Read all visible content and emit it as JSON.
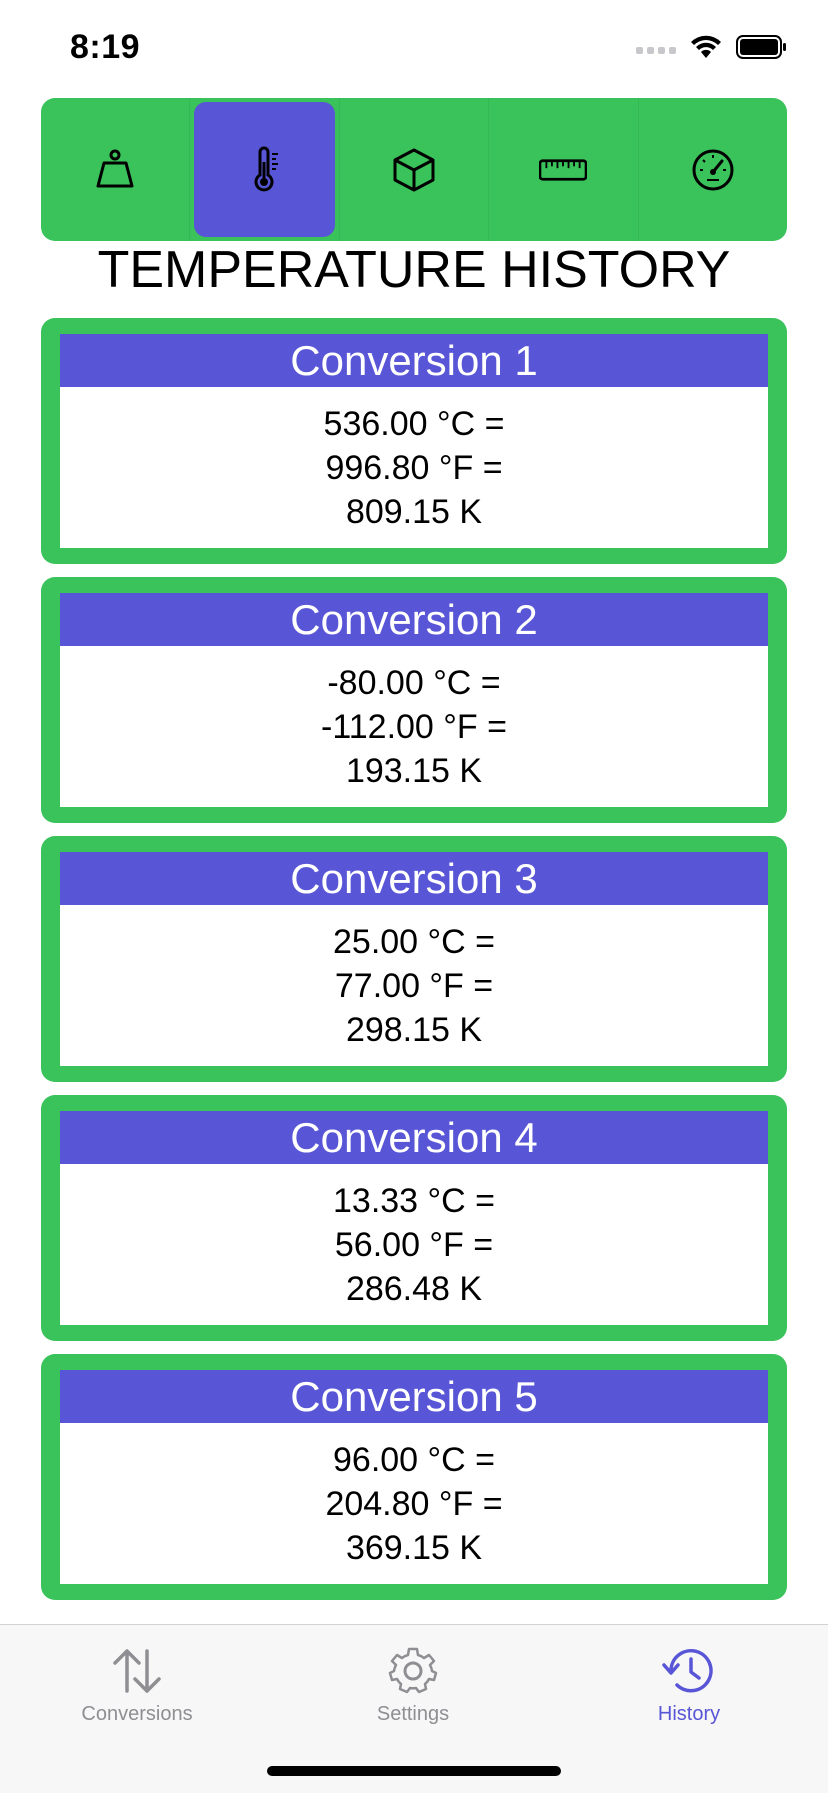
{
  "status": {
    "time": "8:19"
  },
  "categories": [
    {
      "icon": "weight-icon",
      "selected": false
    },
    {
      "icon": "thermometer-icon",
      "selected": true
    },
    {
      "icon": "cube-icon",
      "selected": false
    },
    {
      "icon": "ruler-icon",
      "selected": false
    },
    {
      "icon": "speedometer-icon",
      "selected": false
    }
  ],
  "page_title": "TEMPERATURE HISTORY",
  "history": [
    {
      "title": "Conversion 1",
      "celsius": "536.00 °C =",
      "fahrenheit": "996.80 °F =",
      "kelvin": "809.15 K"
    },
    {
      "title": "Conversion 2",
      "celsius": "-80.00 °C =",
      "fahrenheit": "-112.00 °F =",
      "kelvin": "193.15 K"
    },
    {
      "title": "Conversion 3",
      "celsius": "25.00 °C =",
      "fahrenheit": "77.00 °F =",
      "kelvin": "298.15 K"
    },
    {
      "title": "Conversion 4",
      "celsius": "13.33 °C =",
      "fahrenheit": "56.00 °F =",
      "kelvin": "286.48 K"
    },
    {
      "title": "Conversion 5",
      "celsius": "96.00 °C =",
      "fahrenheit": "204.80 °F =",
      "kelvin": "369.15 K"
    }
  ],
  "tabbar": {
    "conversions_label": "Conversions",
    "settings_label": "Settings",
    "history_label": "History",
    "active": "History"
  },
  "colors": {
    "green": "#3ac25b",
    "purple": "#5856d6",
    "inactive_gray": "#8e8e93"
  }
}
